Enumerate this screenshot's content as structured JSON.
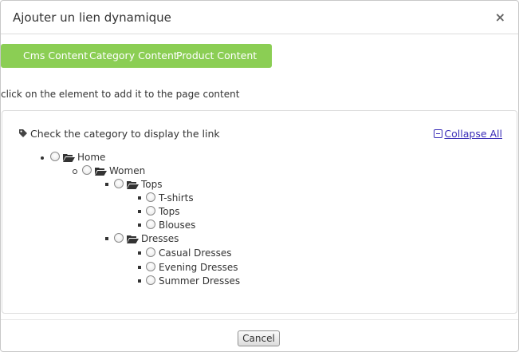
{
  "dialog": {
    "title": "Ajouter un lien dynamique",
    "close_label": "×"
  },
  "tabs": [
    {
      "label": "Cms Content"
    },
    {
      "label": "Category Content"
    },
    {
      "label": "Product Content"
    }
  ],
  "instruction": "click on the element to add it to the page content",
  "tree": {
    "heading": "Check the category to display the link",
    "collapse_label": "Collapse All",
    "nodes": {
      "home": "Home",
      "women": "Women",
      "tops": "Tops",
      "tshirts": "T-shirts",
      "tops_child": "Tops",
      "blouses": "Blouses",
      "dresses": "Dresses",
      "casual": "Casual Dresses",
      "evening": "Evening Dresses",
      "summer": "Summer Dresses"
    }
  },
  "footer": {
    "cancel_label": "Cancel"
  },
  "colors": {
    "tab_bar": "#8bce54",
    "link": "#3b2eb8"
  }
}
